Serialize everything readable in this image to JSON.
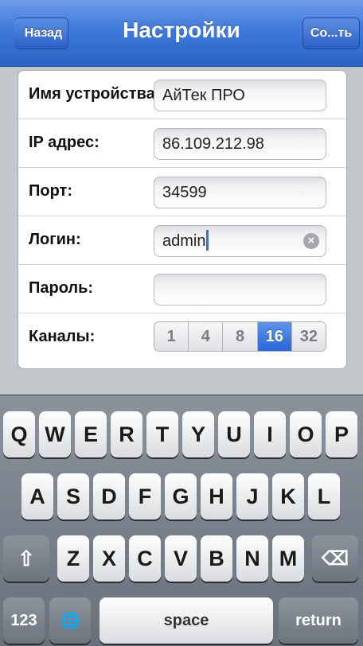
{
  "navbar": {
    "back_label": "Назад",
    "title": "Настройки",
    "save_label": "Со...ть"
  },
  "settings": {
    "device_name": {
      "label": "Имя устройства",
      "value": "АйТек ПРО"
    },
    "ip": {
      "label": "IP адрес:",
      "value": "86.109.212.98"
    },
    "port": {
      "label": "Порт:",
      "value": "34599"
    },
    "login": {
      "label": "Логин:",
      "value": "admin"
    },
    "password": {
      "label": "Пароль:",
      "value": ""
    },
    "channels": {
      "label": "Каналы:",
      "options": [
        "1",
        "4",
        "8",
        "16",
        "32"
      ],
      "selected": "16"
    }
  },
  "keyboard": {
    "row1": [
      "Q",
      "W",
      "E",
      "R",
      "T",
      "Y",
      "U",
      "I",
      "O",
      "P"
    ],
    "row2": [
      "A",
      "S",
      "D",
      "F",
      "G",
      "H",
      "J",
      "K",
      "L"
    ],
    "row3": [
      "Z",
      "X",
      "C",
      "V",
      "B",
      "N",
      "M"
    ],
    "shift": "⇧",
    "backspace": "⌫",
    "numbers": "123",
    "globe": "🌐",
    "space": "space",
    "return": "return"
  },
  "colors": {
    "nav_blue": "#3e79db",
    "selected_segment": "#2a66d6",
    "caret": "#2e72e0"
  }
}
